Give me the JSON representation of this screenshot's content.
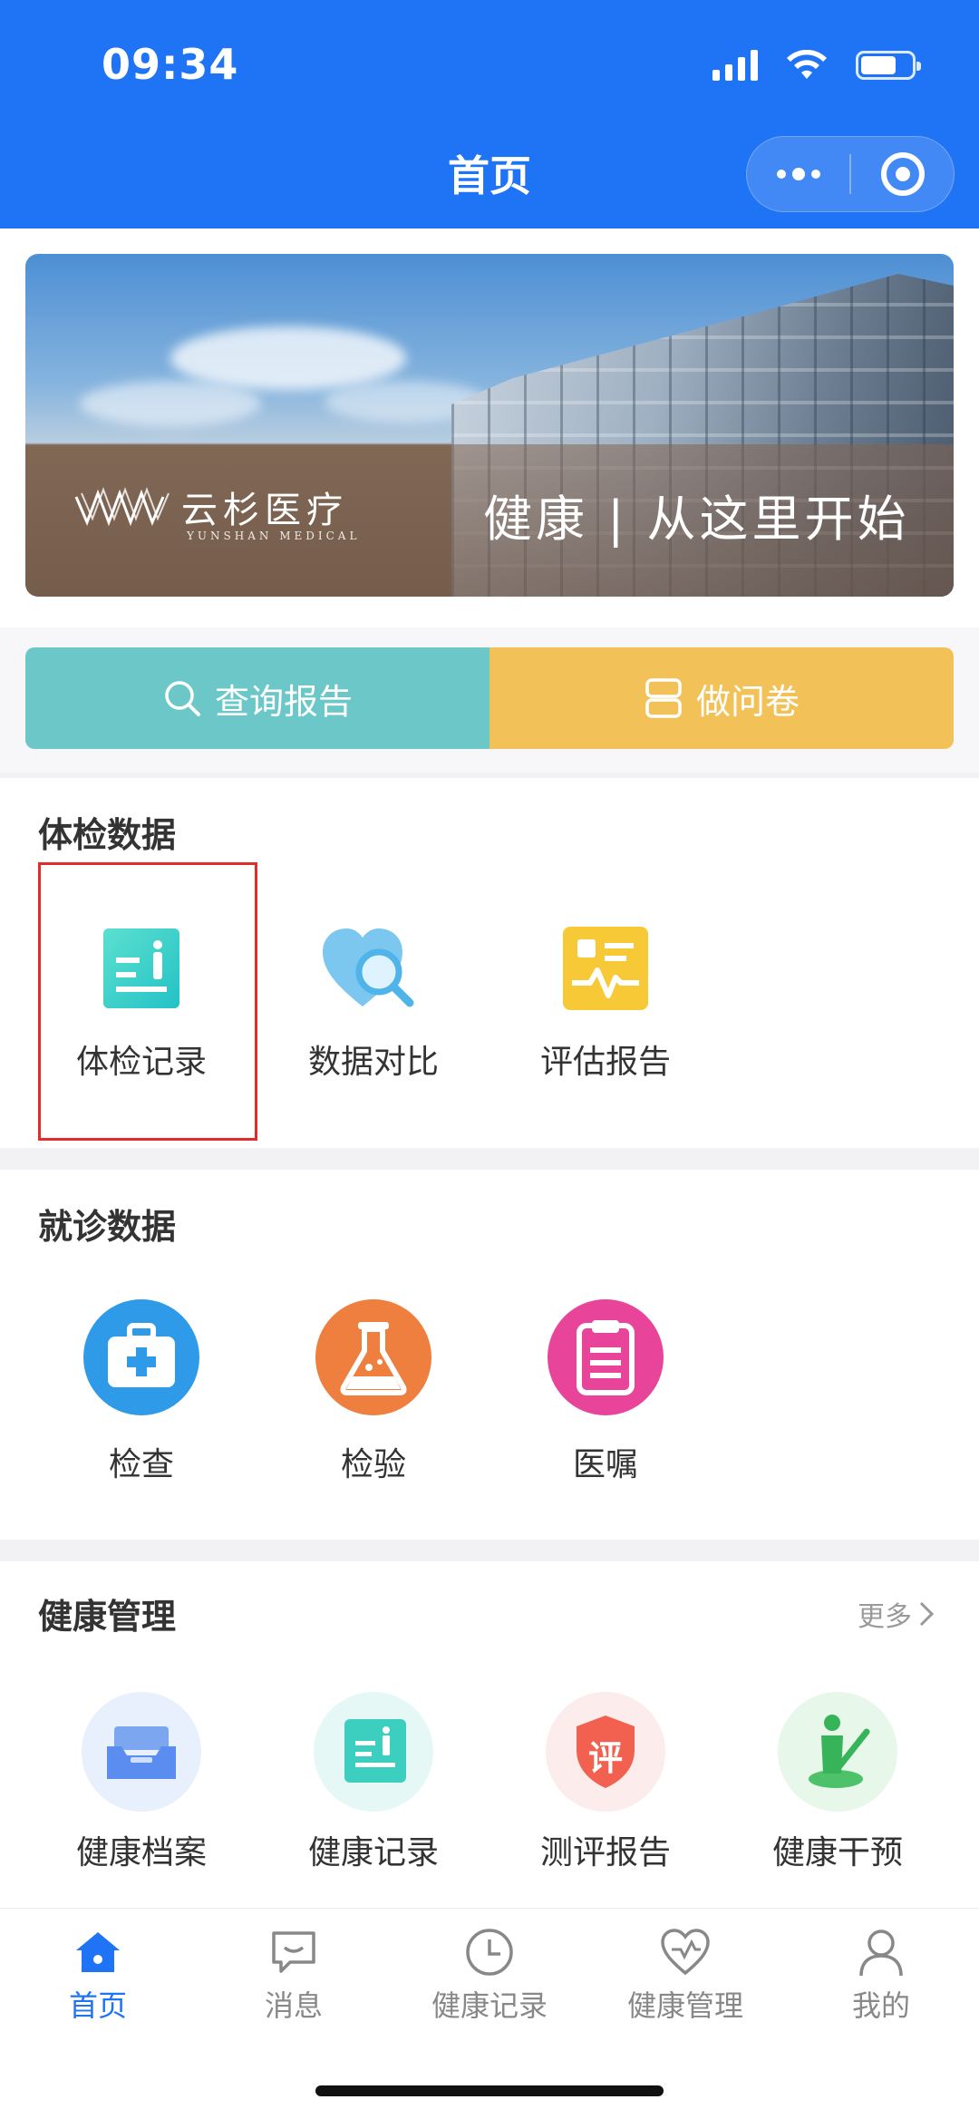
{
  "status_bar": {
    "time": "09:34"
  },
  "nav": {
    "title": "首页"
  },
  "banner": {
    "brand_cn": "云杉医疗",
    "brand_en": "YUNSHAN MEDICAL",
    "slogan": "健康 | 从这里开始"
  },
  "actions": [
    {
      "label": "查询报告",
      "icon": "search-icon",
      "color": "#6cc7c8"
    },
    {
      "label": "做问卷",
      "icon": "survey-icon",
      "color": "#f2c258"
    }
  ],
  "exam_section": {
    "title": "体检数据",
    "items": [
      {
        "label": "体检记录",
        "icon": "exam-record-icon",
        "highlighted": true
      },
      {
        "label": "数据对比",
        "icon": "heart-search-icon"
      },
      {
        "label": "评估报告",
        "icon": "assessment-report-icon"
      }
    ]
  },
  "visit_section": {
    "title": "就诊数据",
    "items": [
      {
        "label": "检查",
        "icon": "medical-kit-icon",
        "color": "#2f9be8"
      },
      {
        "label": "检验",
        "icon": "flask-icon",
        "color": "#ef7f3f"
      },
      {
        "label": "医嘱",
        "icon": "clipboard-icon",
        "color": "#e8459a"
      }
    ]
  },
  "health_section": {
    "title": "健康管理",
    "more": "更多",
    "items": [
      {
        "label": "健康档案",
        "icon": "health-archive-icon"
      },
      {
        "label": "健康记录",
        "icon": "health-record-icon"
      },
      {
        "label": "测评报告",
        "icon": "evaluation-shield-icon",
        "badge": "评"
      },
      {
        "label": "健康干预",
        "icon": "intervention-icon"
      }
    ]
  },
  "tabbar": {
    "active_color": "#1f73f5",
    "tabs": [
      {
        "label": "首页",
        "icon": "home-icon",
        "active": true
      },
      {
        "label": "消息",
        "icon": "message-icon"
      },
      {
        "label": "健康记录",
        "icon": "clock-icon"
      },
      {
        "label": "健康管理",
        "icon": "heart-pulse-icon"
      },
      {
        "label": "我的",
        "icon": "user-icon"
      }
    ]
  }
}
